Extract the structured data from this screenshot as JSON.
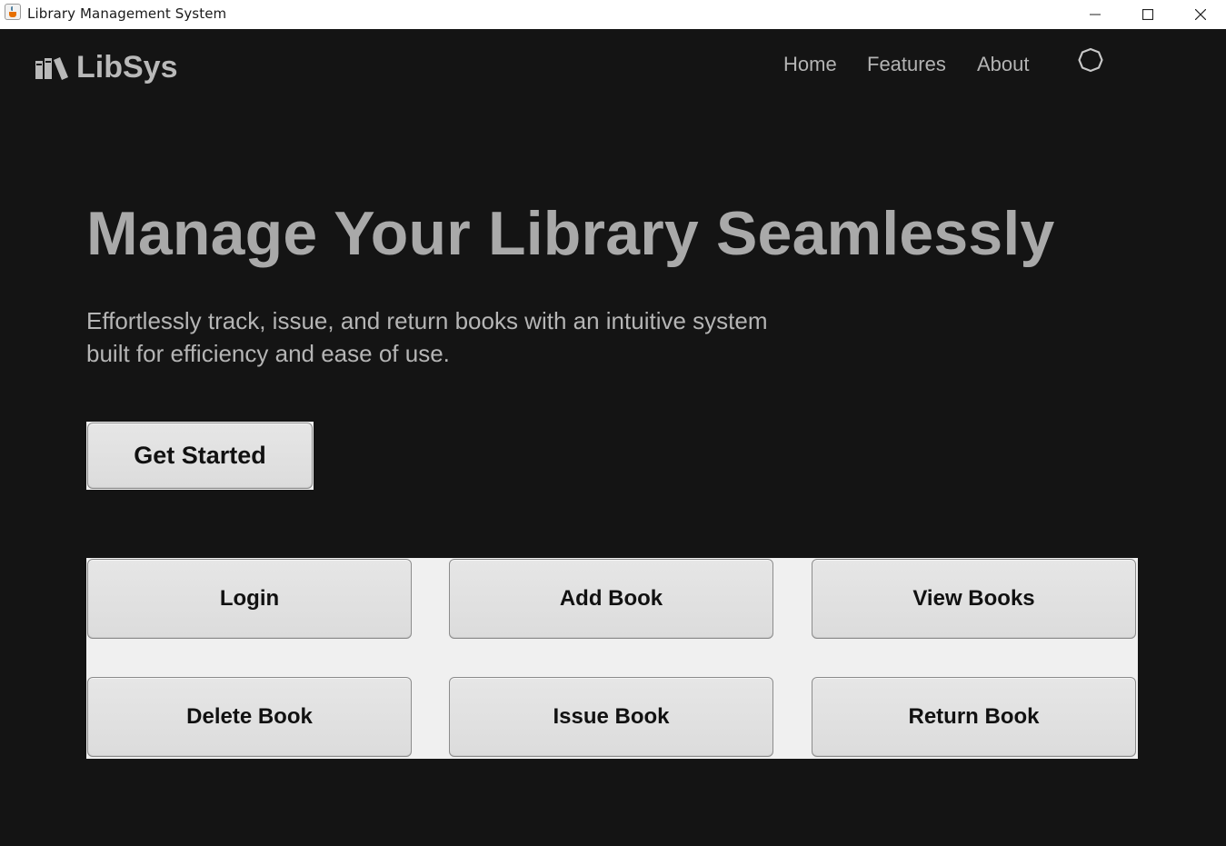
{
  "window": {
    "title": "Library Management System",
    "controls": [
      "minimize-icon",
      "maximize-icon",
      "close-icon"
    ]
  },
  "navbar": {
    "brand_icon": "books-icon",
    "brand_name": "LibSys",
    "links": [
      "Home",
      "Features",
      "About"
    ],
    "settings_icon": "settings-icon"
  },
  "hero": {
    "title": "Manage Your Library Seamlessly",
    "subtitle_line1": "Effortlessly track, issue, and return books with an intuitive system",
    "subtitle_line2": "built for efficiency and ease of use.",
    "cta_label": "Get Started"
  },
  "actions": {
    "login": "Login",
    "add_book": "Add Book",
    "view_books": "View Books",
    "delete_book": "Delete Book",
    "issue_book": "Issue Book",
    "return_book": "Return Book"
  },
  "colors": {
    "background": "#141414",
    "text_muted": "#b3b3b3",
    "button_face": "#e0e0e0",
    "panel": "#f0f0f0"
  }
}
